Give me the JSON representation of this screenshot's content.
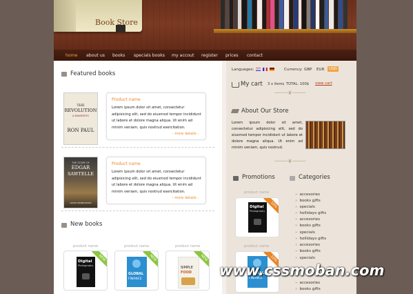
{
  "header": {
    "logo_text": "Book Store",
    "nav": [
      "home",
      "about us",
      "books",
      "specials books",
      "my accout",
      "register",
      "prices",
      "contact"
    ],
    "colors": {
      "nav_active": "#f0a343",
      "accent": "#e8862a"
    }
  },
  "featured": {
    "title": "Featured books",
    "products": [
      {
        "name": "Product name",
        "desc": "Lorem ipsum dolor sit amet, consectetur adipisicing elit, sed do eiusmod tempor incididunt ut labore et dolore magna aliqua. Ut enim ad minim veniam, quis nostrud exercitation.",
        "more": "- more details -",
        "cover": {
          "line1": "THE",
          "line2": "REVOLUTION",
          "line3": "A MANIFESTO",
          "line4": "RON PAUL"
        }
      },
      {
        "name": "Product name",
        "desc": "Lorem ipsum dolor sit amet, consectetur adipisicing elit, sed do eiusmod tempor incididunt ut labore et dolore magna aliqua. Ut enim ad minim veniam, quis nostrud exercitation.",
        "more": "- more details -",
        "cover": {
          "line1": "THE STORY OF",
          "line2": "EDGAR",
          "line3": "SAWTELLE",
          "line4": "DAVID WROBLEWSKI"
        }
      }
    ]
  },
  "new_books": {
    "title": "New books",
    "items": [
      {
        "label": "product name",
        "badge": "NEW",
        "cover_title": "Digital",
        "cover_sub": "Photography"
      },
      {
        "label": "product name",
        "badge": "NEW",
        "cover_title": "GLOBAL",
        "cover_sub": "FINANCE"
      },
      {
        "label": "product name",
        "badge": "NEW",
        "cover_title": "SIMPLE",
        "cover_sub": "FOOD"
      }
    ]
  },
  "sidebar": {
    "languages_label": "Languages:",
    "currency_label": "Currency:",
    "currencies": [
      "GBP",
      "EUR",
      "USD"
    ],
    "active_currency": "USD",
    "cart_title": "My cart",
    "cart_items": "3 x items",
    "cart_total": "TOTAL: 100$",
    "view_cart": "view cart",
    "about_title": "About Our Store",
    "about_text": "Lorem ipsum dolor sit amet, consectetur adipisicing elit, sed do eiusmod tempor incididunt ut labore et dolore magna aliqua. Ut enim ad minim veniam, quis nostrud.",
    "promotions_title": "Promotions",
    "promotions": [
      {
        "label": "product name",
        "badge": "10%",
        "cover_title": "Digital",
        "cover_sub": "Photography"
      },
      {
        "label": "product name",
        "badge": "10%",
        "cover_title": "GLOBAL",
        "cover_sub": "FINANCE"
      }
    ],
    "categories_title": "Categories",
    "categories": [
      "accesories",
      "books gifts",
      "specials",
      "hollidays gifts",
      "accesories",
      "books gifts",
      "specials",
      "hollidays gifts",
      "accesories",
      "books gifts",
      "specials",
      "accesories",
      "books gifts"
    ]
  },
  "watermark": "www.cssmoban.com"
}
